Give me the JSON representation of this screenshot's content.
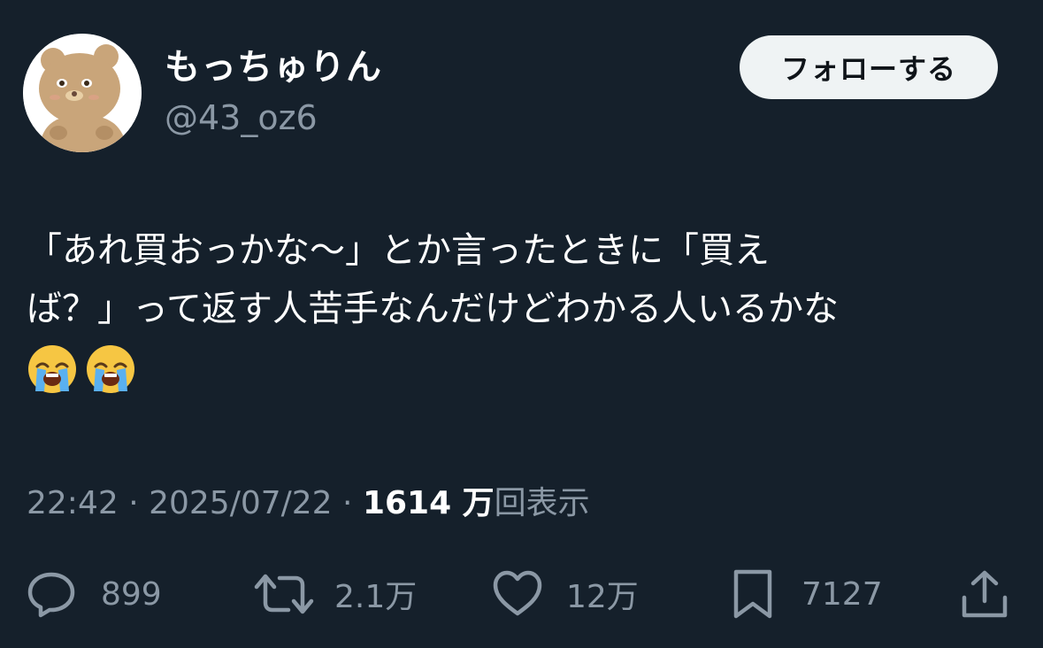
{
  "author": {
    "display_name": "もっちゅりん",
    "handle": "@43_oz6",
    "avatar_icon": "bear-avatar-icon"
  },
  "follow_button": {
    "label": "フォローする"
  },
  "tweet": {
    "lines": [
      "「あれ買おっかな〜」とか言ったときに「買え",
      "ば？」って返す人苦手なんだけどわかる人いるかな"
    ],
    "emojis": [
      "loudly-crying-face-icon",
      "loudly-crying-face-icon"
    ]
  },
  "meta": {
    "time": "22:42",
    "separator1": " · ",
    "date": "2025/07/22",
    "separator2": " · ",
    "views_count": "1614 万",
    "views_label": "回表示"
  },
  "actions": {
    "reply": {
      "icon": "reply-icon",
      "count": "899"
    },
    "retweet": {
      "icon": "retweet-icon",
      "count": "2.1万"
    },
    "like": {
      "icon": "heart-icon",
      "count": "12万"
    },
    "bookmark": {
      "icon": "bookmark-icon",
      "count": "7127"
    },
    "share": {
      "icon": "share-icon"
    }
  },
  "colors": {
    "background": "#15202b",
    "text_primary": "#ffffff",
    "text_secondary": "#8b98a5",
    "button_bg": "#eff3f4",
    "button_text": "#0f1419"
  }
}
